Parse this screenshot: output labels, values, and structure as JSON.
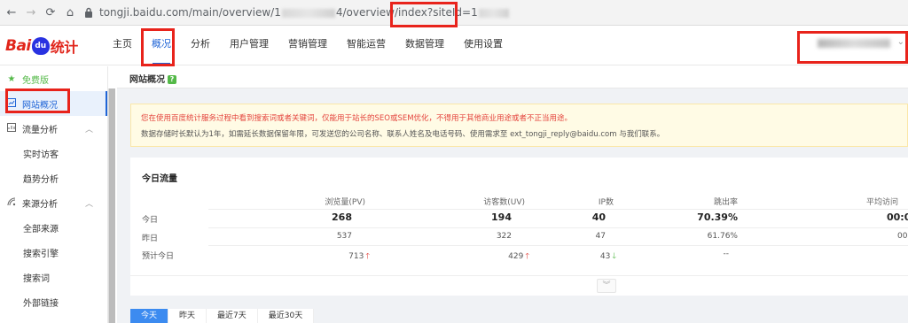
{
  "browser": {
    "back": "←",
    "forward": "→",
    "reload": "⟳",
    "home": "⌂",
    "url_prefix": "tongji.baidu.com/main/overview/1",
    "url_mid": "4/overview/index?siteId=1"
  },
  "logo": {
    "bai": "Bai",
    "du": "du",
    "tongji": "统计"
  },
  "menu": [
    "主页",
    "概况",
    "分析",
    "用户管理",
    "营销管理",
    "智能运营",
    "数据管理",
    "使用设置"
  ],
  "user": {
    "caret": "⌄"
  },
  "sidebar": {
    "free": "免费版",
    "site_overview": "网站概况",
    "traffic": "流量分析",
    "realtime": "实时访客",
    "trend": "趋势分析",
    "source": "来源分析",
    "all_source": "全部来源",
    "search_engine": "搜索引擎",
    "search_words": "搜索词",
    "external_links": "外部链接"
  },
  "page": {
    "title": "网站概况",
    "q": "?"
  },
  "notice": {
    "line1": "您在使用百度统计服务过程中看到搜索词或者关键词，仅能用于站长的SEO或SEM优化，不得用于其他商业用途或者不正当用途。",
    "line2": "数据存储时长默认为1年，如需延长数据保留年限，可发送您的公司名称、联系人姓名及电话号码、使用需求至 ext_tongji_reply@baidu.com 与我们联系。"
  },
  "today": {
    "title": "今日流量",
    "headers": [
      "浏览量(PV)",
      "访客数(UV)",
      "IP数",
      "跳出率",
      "平均访问"
    ],
    "rows": [
      {
        "label": "今日",
        "pv": "268",
        "uv": "194",
        "ip": "40",
        "bounce": "70.39%",
        "avg": "00:0"
      },
      {
        "label": "昨日",
        "pv": "537",
        "uv": "322",
        "ip": "47",
        "bounce": "61.76%",
        "avg": "00:"
      },
      {
        "label": "预计今日",
        "pv": "713",
        "uv": "429",
        "ip": "43",
        "bounce": "--",
        "avg": ""
      }
    ],
    "pv_trend": "up",
    "uv_trend": "up",
    "ip_trend": "down",
    "expand": "︾"
  },
  "date_tabs": [
    "今天",
    "昨天",
    "最近7天",
    "最近30天"
  ],
  "colors": {
    "accent": "#1f64d6",
    "brand_red": "#e1251b",
    "annotation": "#e8231b"
  }
}
